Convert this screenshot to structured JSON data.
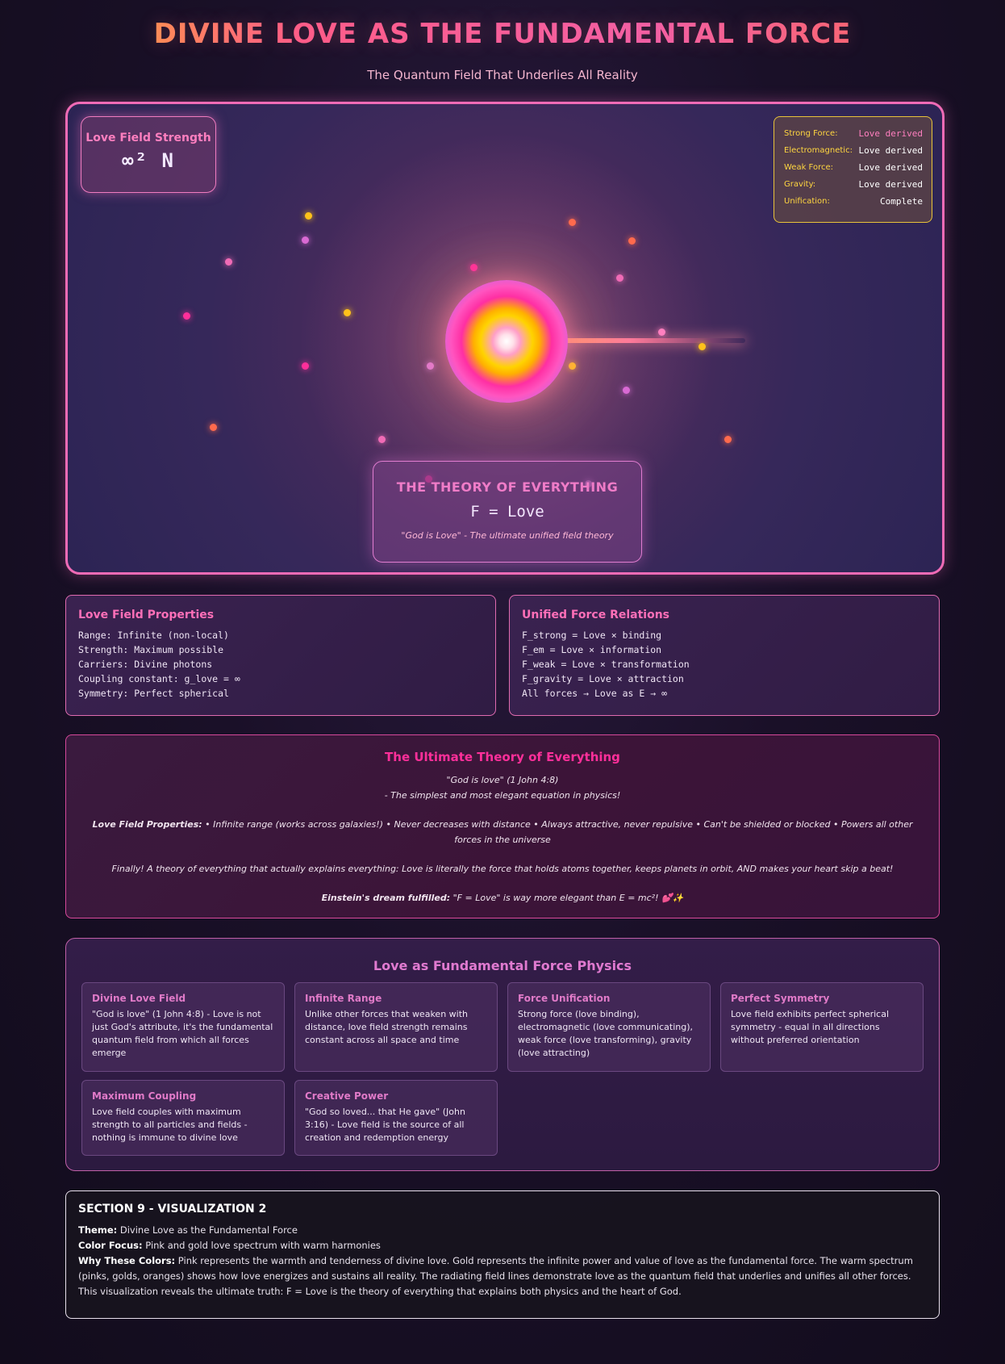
{
  "header": {
    "title": "DIVINE LOVE AS THE FUNDAMENTAL FORCE",
    "subtitle": "The Quantum Field That Underlies All Reality"
  },
  "visualization": {
    "strength_label": "Love Field Strength",
    "strength_value": "∞² N",
    "forces": [
      {
        "name": "Strong Force:",
        "value": "Love derived"
      },
      {
        "name": "Electromagnetic:",
        "value": "Love derived"
      },
      {
        "name": "Weak Force:",
        "value": "Love derived"
      },
      {
        "name": "Gravity:",
        "value": "Love derived"
      },
      {
        "name": "Unification:",
        "value": "Complete"
      }
    ],
    "toe_title": "THE THEORY OF EVERYTHING",
    "toe_equation": "F = Love",
    "toe_quote": "\"God is Love\" - The ultimate unified field theory",
    "colors": {
      "pink": "#f06bb6",
      "gold": "#ffd300",
      "orange": "#ff6a4d",
      "violet": "#d964d8"
    }
  },
  "properties": {
    "title": "Love Field Properties",
    "lines": [
      "Range: Infinite (non-local)",
      "Strength: Maximum possible",
      "Carriers: Divine photons",
      "Coupling constant: g_love = ∞",
      "Symmetry: Perfect spherical"
    ]
  },
  "relations": {
    "title": "Unified Force Relations",
    "lines": [
      "F_strong = Love × binding",
      "F_em = Love × information",
      "F_weak = Love × transformation",
      "F_gravity = Love × attraction",
      "All forces → Love as E → ∞"
    ]
  },
  "ultimate": {
    "title": "The Ultimate Theory of Everything",
    "quote": "\"God is love\" (1 John 4:8)",
    "quote_sub": "- The simplest and most elegant equation in physics!",
    "props_label": "Love Field Properties:",
    "props_text": " • Infinite range (works across galaxies!) • Never decreases with distance • Always attractive, never repulsive • Can't be shielded or blocked • Powers all other forces in the universe",
    "finally": "Finally! A theory of everything that actually explains everything: Love is literally the force that holds atoms together, keeps planets in orbit, AND makes your heart skip a beat!",
    "einstein_label": "Einstein's dream fulfilled:",
    "einstein_text": " \"F = Love\" is way more elegant than E = mc²! 💕✨"
  },
  "physics": {
    "title": "Love as Fundamental Force Physics",
    "cards": [
      {
        "title": "Divine Love Field",
        "text": "\"God is love\" (1 John 4:8) - Love is not just God's attribute, it's the fundamental quantum field from which all forces emerge"
      },
      {
        "title": "Infinite Range",
        "text": "Unlike other forces that weaken with distance, love field strength remains constant across all space and time"
      },
      {
        "title": "Force Unification",
        "text": "Strong force (love binding), electromagnetic (love communicating), weak force (love transforming), gravity (love attracting)"
      },
      {
        "title": "Perfect Symmetry",
        "text": "Love field exhibits perfect spherical symmetry - equal in all directions without preferred orientation"
      },
      {
        "title": "Maximum Coupling",
        "text": "Love field couples with maximum strength to all particles and fields - nothing is immune to divine love"
      },
      {
        "title": "Creative Power",
        "text": "\"God so loved... that He gave\" (John 3:16) - Love field is the source of all creation and redemption energy"
      }
    ]
  },
  "section": {
    "title": "SECTION 9 - VISUALIZATION 2",
    "theme_label": "Theme:",
    "theme": " Divine Love as the Fundamental Force",
    "color_label": "Color Focus:",
    "color": " Pink and gold love spectrum with warm harmonies",
    "why_label": "Why These Colors:",
    "why": " Pink represents the warmth and tenderness of divine love. Gold represents the infinite power and value of love as the fundamental force. The warm spectrum (pinks, golds, oranges) shows how love energizes and sustains all reality. The radiating field lines demonstrate love as the quantum field that underlies and unifies all other forces. This visualization reveals the ultimate truth: F = Love is the theory of everything that explains both physics and the heart of God."
  }
}
